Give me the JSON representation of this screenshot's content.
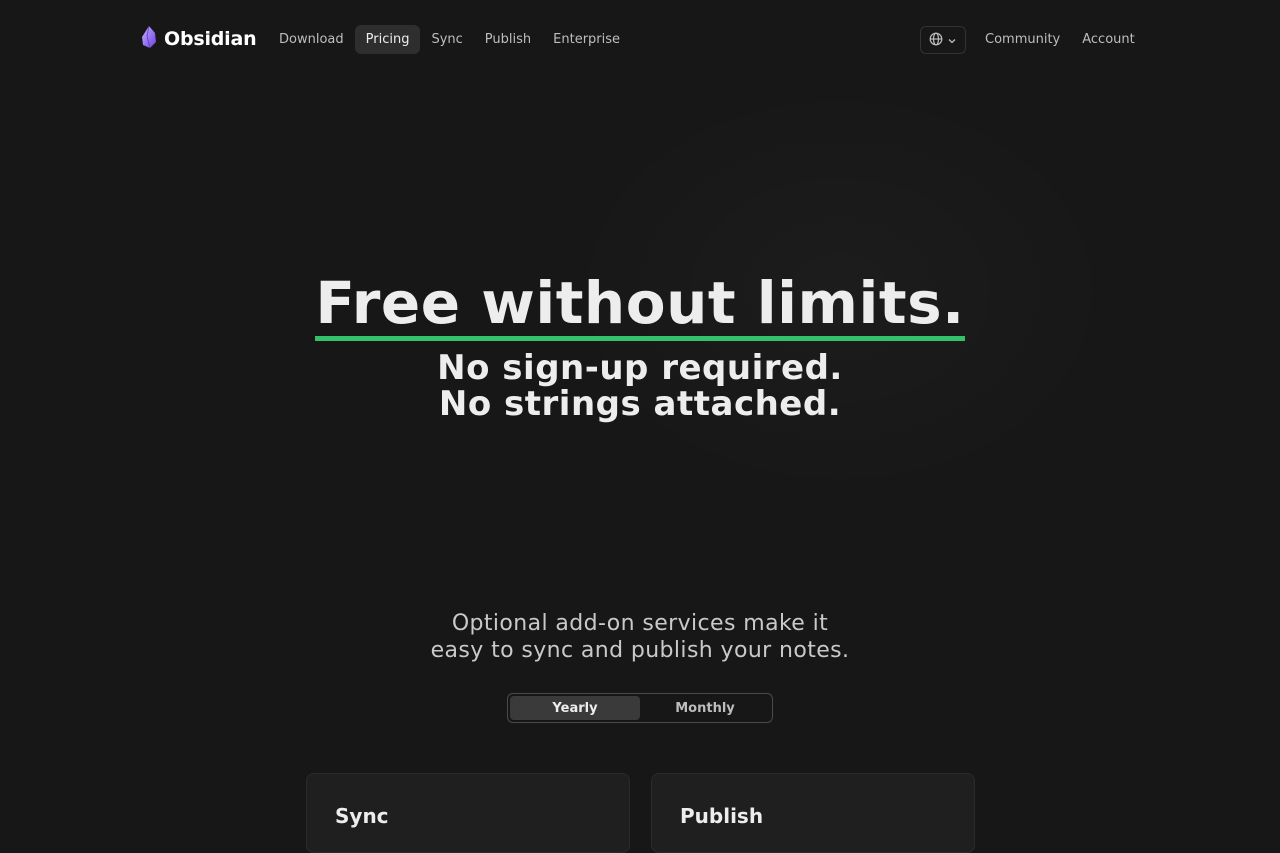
{
  "brand": {
    "name": "Obsidian",
    "accent": "#8a5cf5"
  },
  "nav": {
    "links": [
      {
        "label": "Download"
      },
      {
        "label": "Pricing",
        "active": true
      },
      {
        "label": "Sync"
      },
      {
        "label": "Publish"
      },
      {
        "label": "Enterprise"
      }
    ],
    "language_icon": "globe-icon",
    "right_links": [
      {
        "label": "Community"
      },
      {
        "label": "Account"
      }
    ]
  },
  "hero": {
    "title": "Free without limits.",
    "underline_color": "#33c26a",
    "subtitle_line1": "No sign-up required.",
    "subtitle_line2": "No strings attached."
  },
  "addons": {
    "tagline_line1": "Optional add-on services make it",
    "tagline_line2": "easy to sync and publish your notes."
  },
  "billing_toggle": {
    "options": [
      "Yearly",
      "Monthly"
    ],
    "selected": "Yearly"
  },
  "cards": [
    {
      "title": "Sync"
    },
    {
      "title": "Publish"
    }
  ]
}
